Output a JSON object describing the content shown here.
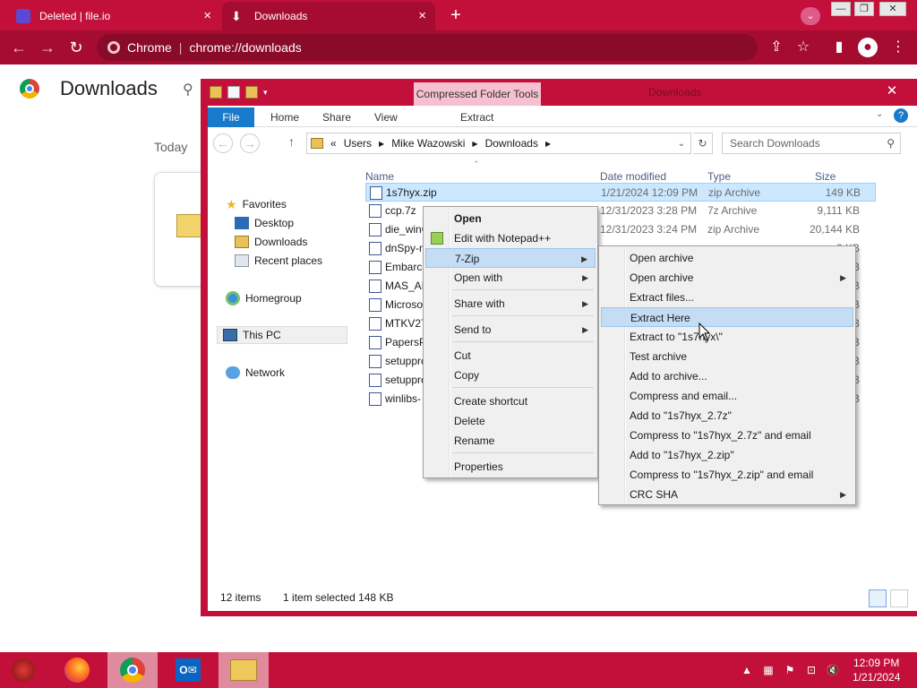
{
  "chrome": {
    "tabs": [
      {
        "title": "Deleted | file.io"
      },
      {
        "title": "Downloads"
      }
    ],
    "omnibox": {
      "scheme_label": "Chrome",
      "url": "chrome://downloads"
    },
    "page": {
      "title": "Downloads",
      "date_group": "Today"
    }
  },
  "explorer": {
    "title": "Downloads",
    "contextual_tab": "Compressed Folder Tools",
    "ribbon_tabs": [
      "File",
      "Home",
      "Share",
      "View",
      "Extract"
    ],
    "breadcrumb": [
      "«",
      "Users",
      "Mike Wazowski",
      "Downloads"
    ],
    "search_placeholder": "Search Downloads",
    "columns": {
      "name": "Name",
      "date": "Date modified",
      "type": "Type",
      "size": "Size"
    },
    "nav": {
      "favorites": "Favorites",
      "desktop": "Desktop",
      "downloads": "Downloads",
      "recent": "Recent places",
      "homegroup": "Homegroup",
      "this_pc": "This PC",
      "network": "Network"
    },
    "files": [
      {
        "name": "1s7hyx.zip",
        "date": "1/21/2024 12:09 PM",
        "type": "zip Archive",
        "size": "149 KB",
        "selected": true
      },
      {
        "name": "ccp.7z",
        "date": "12/31/2023 3:28 PM",
        "type": "7z Archive",
        "size": "9,111 KB"
      },
      {
        "name": "die_win6",
        "date": "12/31/2023 3:24 PM",
        "type": "zip Archive",
        "size": "20,144 KB"
      },
      {
        "name": "dnSpy-n",
        "date": "",
        "type": "",
        "size": "2 KB"
      },
      {
        "name": "Embarca",
        "date": "",
        "type": "",
        "size": "2 KB"
      },
      {
        "name": "MAS_AI",
        "date": "",
        "type": "",
        "size": "5 KB"
      },
      {
        "name": "Microso",
        "date": "",
        "type": "",
        "size": "2 KB"
      },
      {
        "name": "MTKV27",
        "date": "",
        "type": "",
        "size": "2 KB"
      },
      {
        "name": "PapersP",
        "date": "",
        "type": "",
        "size": "0 KB"
      },
      {
        "name": "setuppro",
        "date": "",
        "type": "",
        "size": "4 KB"
      },
      {
        "name": "setuppro",
        "date": "",
        "type": "",
        "size": "4 KB"
      },
      {
        "name": "winlibs-",
        "date": "",
        "type": "",
        "size": "2 KB"
      }
    ],
    "status": {
      "count": "12 items",
      "selection": "1 item selected  148 KB"
    }
  },
  "context_menu": {
    "items": [
      "Open",
      "Edit with Notepad++",
      "7-Zip",
      "Open with",
      "Share with",
      "Send to",
      "Cut",
      "Copy",
      "Create shortcut",
      "Delete",
      "Rename",
      "Properties"
    ]
  },
  "zip_menu": {
    "items": [
      "Open archive",
      "Open archive",
      "Extract files...",
      "Extract Here",
      "Extract to \"1s7hyx\\\"",
      "Test archive",
      "Add to archive...",
      "Compress and email...",
      "Add to \"1s7hyx_2.7z\"",
      "Compress to \"1s7hyx_2.7z\" and email",
      "Add to \"1s7hyx_2.zip\"",
      "Compress to \"1s7hyx_2.zip\" and email",
      "CRC SHA"
    ]
  },
  "taskbar": {
    "time": "12:09 PM",
    "date": "1/21/2024"
  },
  "colors": {
    "accent": "#c3103b",
    "accent_dark": "#a60c30",
    "selection": "#cce8ff",
    "menu_highlight": "#c4dcf4"
  }
}
